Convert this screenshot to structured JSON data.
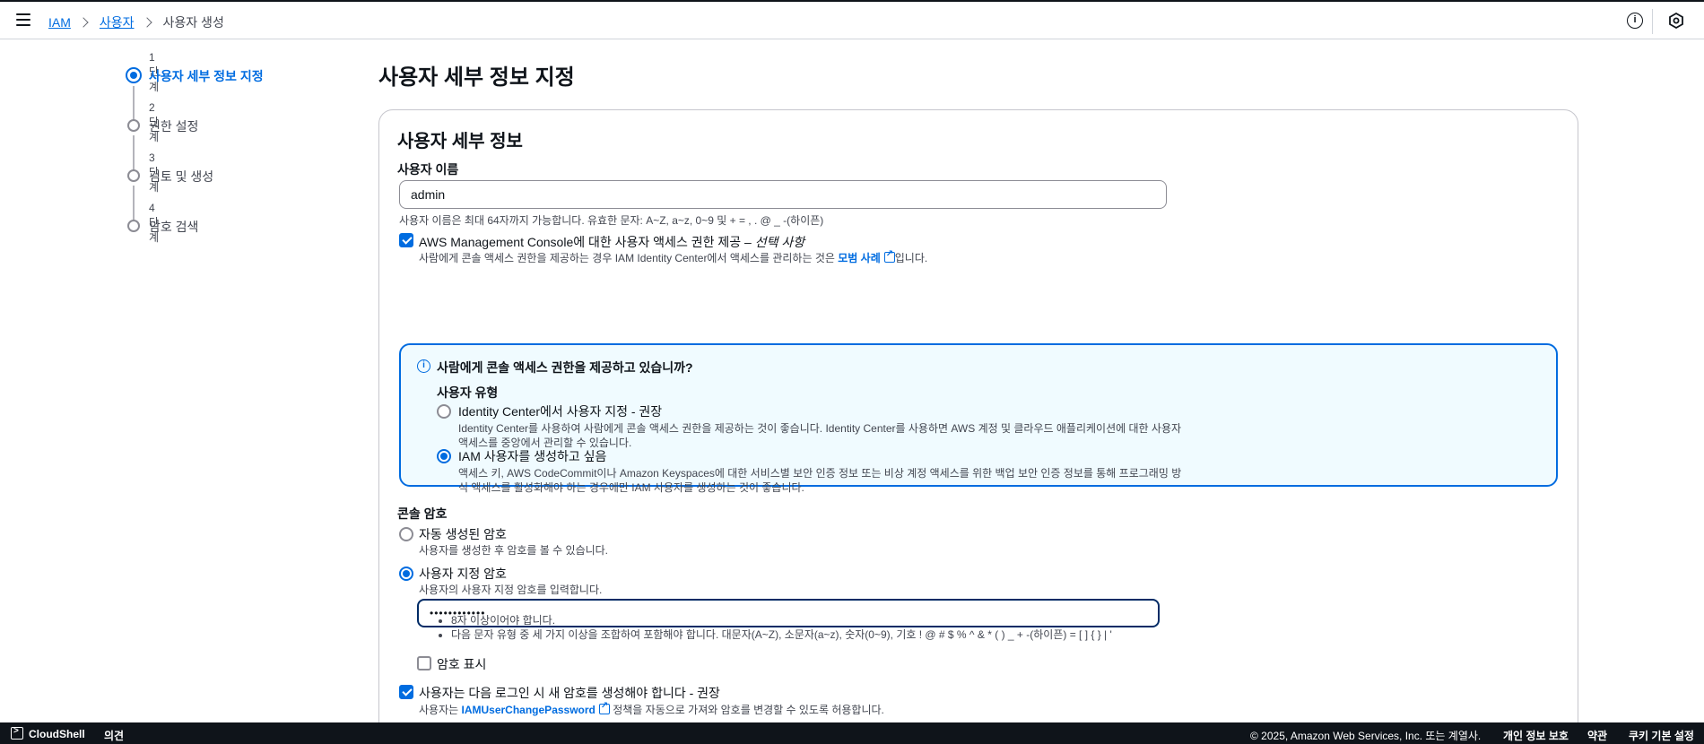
{
  "breadcrumb": {
    "iam": "IAM",
    "users": "사용자",
    "current": "사용자 생성"
  },
  "steps": [
    {
      "num": "1단계",
      "label": "사용자 세부 정보 지정"
    },
    {
      "num": "2단계",
      "label": "권한 설정"
    },
    {
      "num": "3단계",
      "label": "검토 및 생성"
    },
    {
      "num": "4단계",
      "label": "암호 검색"
    }
  ],
  "page_title": "사용자 세부 정보 지정",
  "panel": {
    "title": "사용자 세부 정보",
    "username_label": "사용자 이름",
    "username_value": "admin",
    "username_hint": "사용자 이름은 최대 64자까지 가능합니다. 유효한 문자: A~Z, a~z, 0~9 및 + = , . @ _ -(하이픈)",
    "console_access_label": "AWS Management Console에 대한 사용자 액세스 권한 제공 – ",
    "console_access_optional": "선택 사항",
    "console_access_hint_pre": "사람에게 콘솔 액세스 권한을 제공하는 경우 IAM Identity Center에서 액세스를 관리하는 것은 ",
    "console_access_hint_link": "모범 사례",
    "console_access_hint_post": "입니다.",
    "info_box": {
      "title": "사람에게 콘솔 액세스 권한을 제공하고 있습니까?",
      "user_type_label": "사용자 유형",
      "option1_label": "Identity Center에서 사용자 지정 - 권장",
      "option1_desc_1": "Identity Center를 사용하여 사람에게 콘솔 액세스 권한을 제공하는 것이 좋습니다. Identity Center를 사용하면 AWS 계정 및 클라우드 애플리케이션에 대한 사용자",
      "option1_desc_2": "액세스를 중앙에서 관리할 수 있습니다.",
      "option2_label": "IAM 사용자를 생성하고 싶음",
      "option2_desc_1": "액세스 키, AWS CodeCommit이나 Amazon Keyspaces에 대한 서비스별 보안 인증 정보 또는 비상 계정 액세스를 위한 백업 보안 인증 정보를 통해 프로그래밍 방",
      "option2_desc_2": "식 액세스를 활성화해야 하는 경우에만 IAM 사용자를 생성하는 것이 좋습니다."
    },
    "console_password_label": "콘솔 암호",
    "autogen_label": "자동 생성된 암호",
    "autogen_desc": "사용자를 생성한 후 암호를 볼 수 있습니다.",
    "custom_label": "사용자 지정 암호",
    "custom_desc": "사용자의 사용자 지정 암호를 입력합니다.",
    "password_value": "••••••••••••",
    "rules": [
      "8자 이상이어야 합니다.",
      "다음 문자 유형 중 세 가지 이상을 조합하여 포함해야 합니다. 대문자(A~Z), 소문자(a~z), 숫자(0~9), 기호 ! @ # $ % ^ & * ( ) _ + -(하이픈) = [ ] { } | '"
    ],
    "show_password_label": "암호 표시",
    "must_change_label": "사용자는 다음 로그인 시 새 암호를 생성해야 합니다 - 권장",
    "must_change_hint_pre": "사용자는 ",
    "must_change_hint_link": "IAMUserChangePassword",
    "must_change_hint_post": " 정책을 자동으로 가져와 암호를 변경할 수 있도록 허용합니다."
  },
  "footer": {
    "cloudshell": "CloudShell",
    "feedback": "의견",
    "copyright": "© 2025, Amazon Web Services, Inc. 또는 계열사.",
    "privacy": "개인 정보 보호",
    "terms": "약관",
    "cookies": "쿠키 기본 설정"
  },
  "colors": {
    "accent": "#006ce0",
    "info_bg": "#f0fbff",
    "footer_bg": "#0f141a"
  }
}
